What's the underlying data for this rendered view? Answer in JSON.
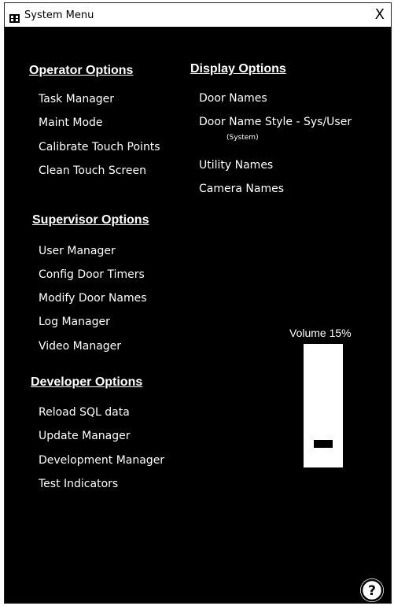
{
  "window": {
    "title": "System Menu",
    "close_label": "X"
  },
  "operator": {
    "title": "Operator Options",
    "items": [
      "Task Manager",
      "Maint Mode",
      "Calibrate Touch Points",
      "Clean Touch Screen"
    ]
  },
  "display": {
    "title": "Display Options",
    "items": [
      "Door Names",
      "Door Name Style - Sys/User",
      "Utility Names",
      "Camera Names"
    ],
    "door_name_style_current": "(System)"
  },
  "supervisor": {
    "title": "Supervisor Options",
    "items": [
      "User Manager",
      "Config Door Timers",
      "Modify Door Names",
      "Log Manager",
      "Video Manager"
    ]
  },
  "developer": {
    "title": "Developer Options",
    "items": [
      "Reload SQL data",
      "Update Manager",
      "Development Manager",
      "Test Indicators"
    ]
  },
  "volume": {
    "label": "Volume 15%",
    "level_percent": 15
  },
  "icons": {
    "app": "app-grid-icon",
    "help": "help-question-icon"
  },
  "colors": {
    "background": "#000000",
    "text": "#ffffff",
    "titlebar": "#ffffff"
  }
}
